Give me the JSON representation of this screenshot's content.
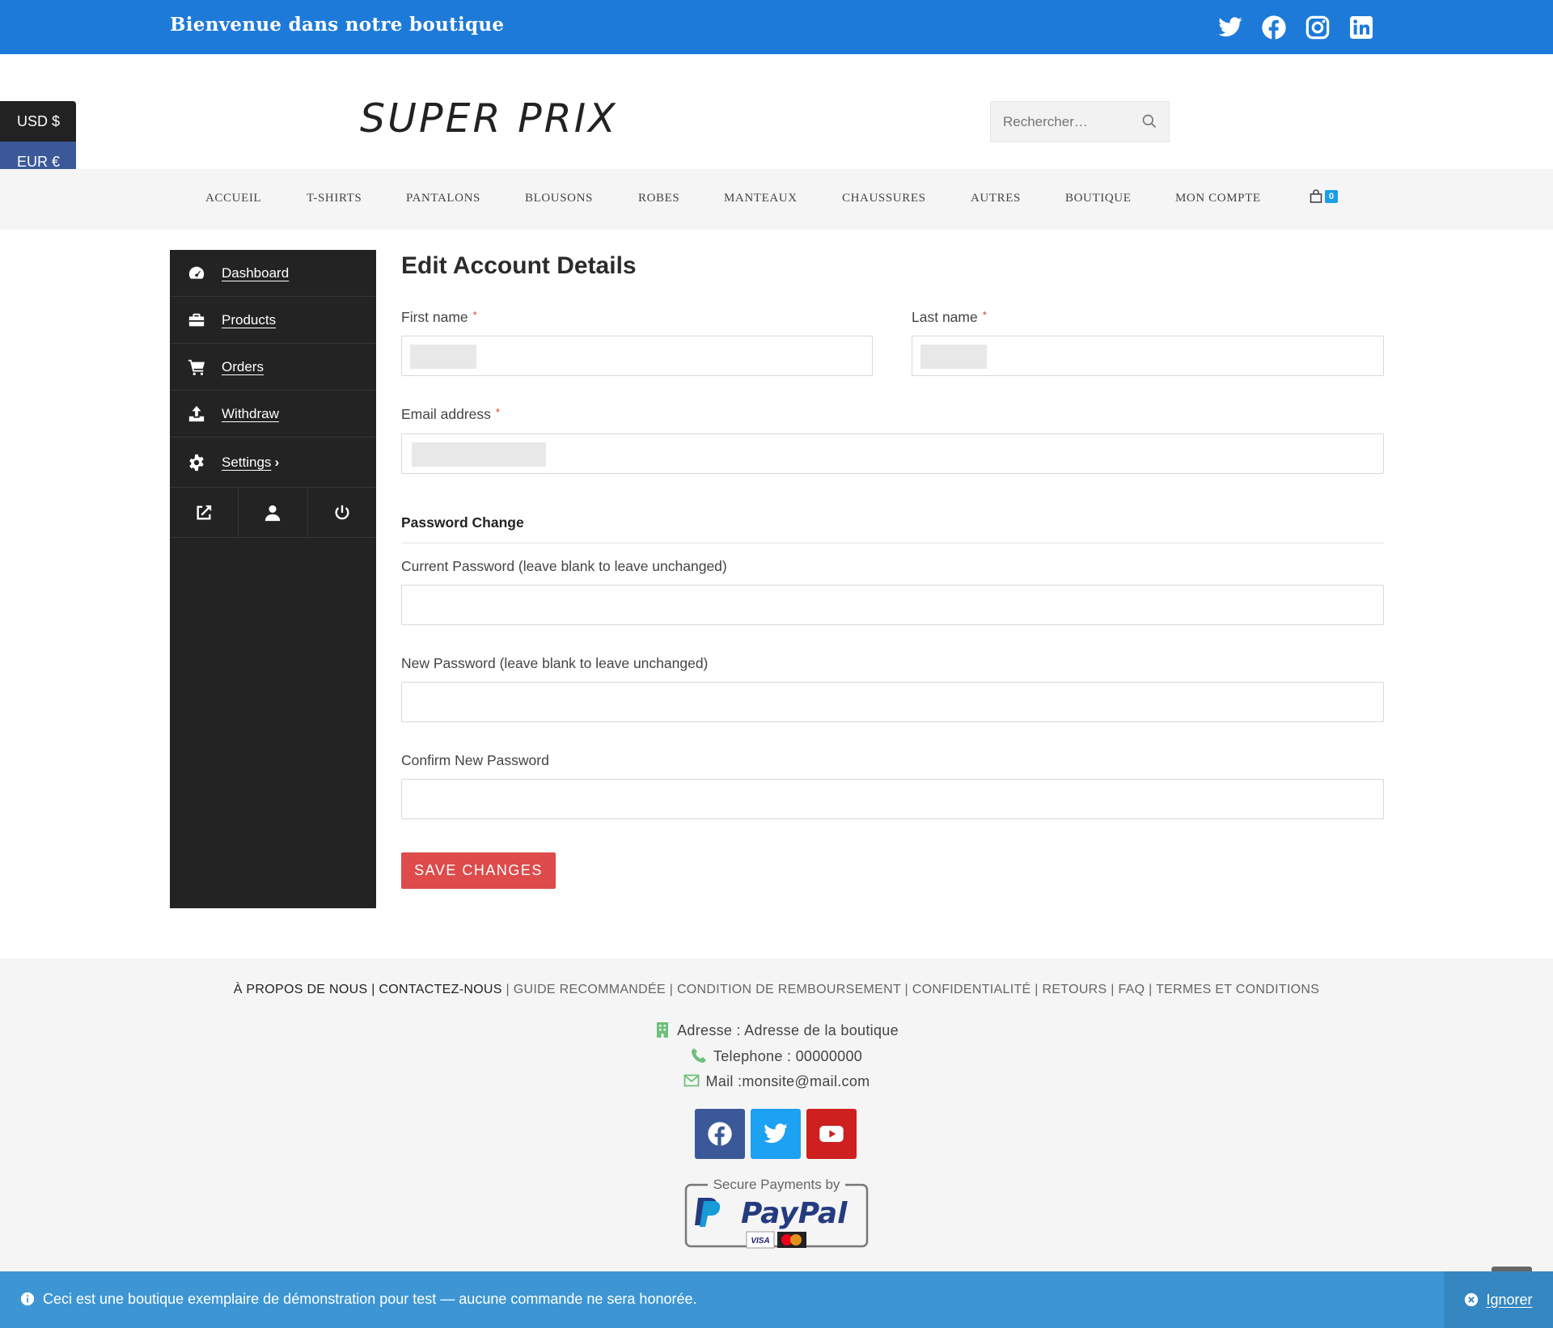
{
  "topbar": {
    "welcome": "Bienvenue dans notre boutique",
    "socials": [
      "twitter-icon",
      "facebook-icon",
      "instagram-icon",
      "linkedin-icon"
    ]
  },
  "currency": {
    "usd": "USD $",
    "eur": "EUR €"
  },
  "header": {
    "logo": "SUPER PRIX",
    "search_placeholder": "Rechercher…"
  },
  "nav": {
    "items": [
      "ACCUEIL",
      "T-SHIRTS",
      "PANTALONS",
      "BLOUSONS",
      "ROBES",
      "MANTEAUX",
      "CHAUSSURES",
      "AUTRES",
      "BOUTIQUE",
      "MON COMPTE"
    ],
    "cart_count": "0"
  },
  "sidebar": {
    "items": [
      {
        "label": "Dashboard",
        "icon": "dashboard-icon"
      },
      {
        "label": "Products",
        "icon": "briefcase-icon"
      },
      {
        "label": "Orders",
        "icon": "cart-icon"
      },
      {
        "label": "Withdraw",
        "icon": "upload-icon"
      },
      {
        "label": "Settings",
        "icon": "gear-icon"
      }
    ],
    "bottom_icons": [
      "external-link-icon",
      "user-icon",
      "power-icon"
    ]
  },
  "form": {
    "title": "Edit Account Details",
    "first_name_label": "First name",
    "last_name_label": "Last name",
    "email_label": "Email address",
    "required_mark": "*",
    "password_section": "Password Change",
    "current_password_label": "Current Password (leave blank to leave unchanged)",
    "new_password_label": "New Password (leave blank to leave unchanged)",
    "confirm_password_label": "Confirm New Password",
    "save_button": "SAVE CHANGES"
  },
  "footer": {
    "links": [
      "À PROPOS DE NOUS",
      "CONTACTEZ-NOUS",
      "GUIDE RECOMMANDÉE",
      "CONDITION DE REMBOURSEMENT",
      "CONFIDENTIALITÉ",
      "RETOURS",
      "FAQ",
      "TERMES ET CONDITIONS"
    ],
    "separator": "|",
    "address": "Adresse : Adresse de la boutique",
    "phone": "Telephone : 00000000",
    "mail": "Mail :monsite@mail.com",
    "paypal_caption": "Secure Payments by",
    "paypal_logo": "PayPal"
  },
  "colors": {
    "topbar": "#1d7ad9",
    "sidebar": "#232323",
    "save_button": "#dd4b4b",
    "notice": "#3d96d3",
    "facebook": "#3b5998",
    "twitter": "#1da1f2",
    "youtube": "#cd201f",
    "contact_icon": "#6ec07c"
  },
  "notice": {
    "message": "Ceci est une boutique exemplaire de démonstration pour test — aucune commande ne sera honorée.",
    "dismiss": "Ignorer"
  }
}
